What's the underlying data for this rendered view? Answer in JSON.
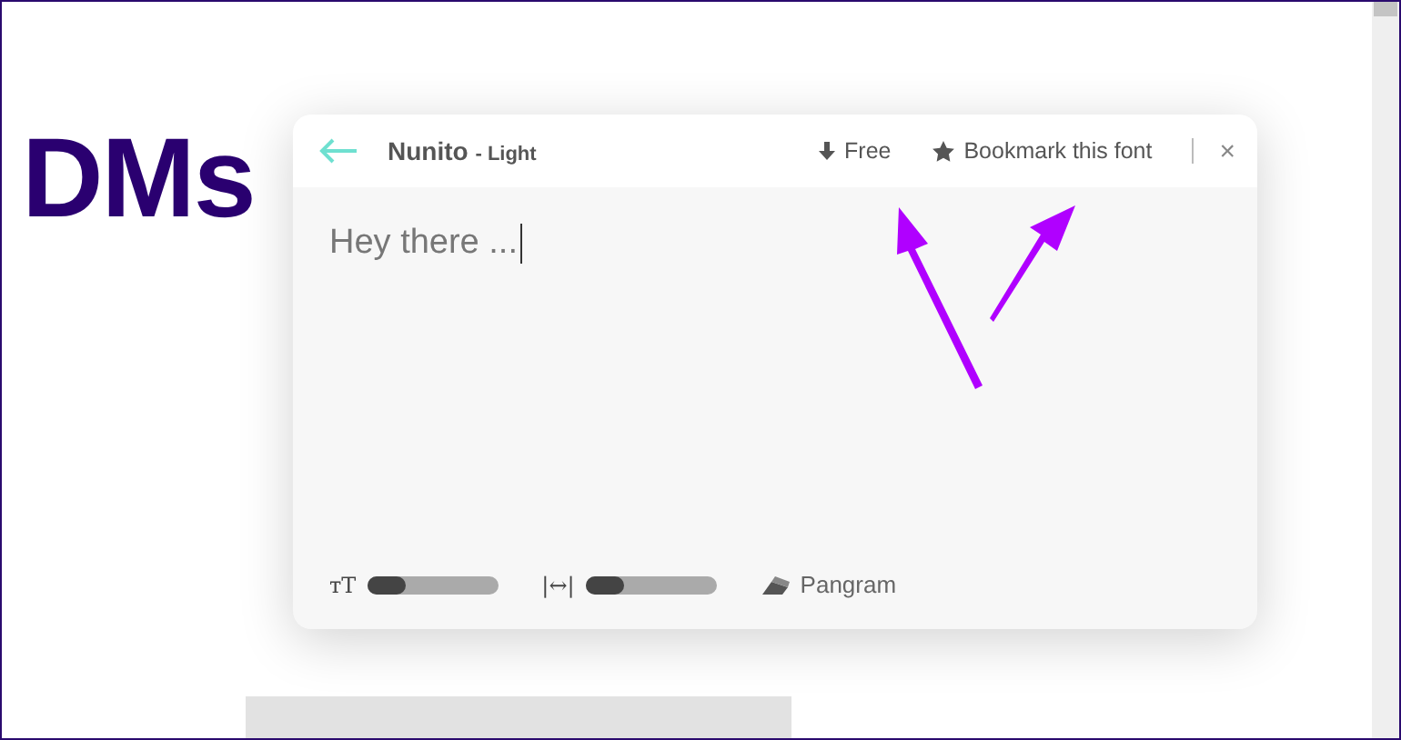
{
  "page": {
    "heading": "DMs"
  },
  "dialog": {
    "font_name": "Nunito",
    "font_style": "- Light",
    "download_label": "Free",
    "bookmark_label": "Bookmark this font",
    "close_label": "×",
    "sample_text": "Hey there ...",
    "controls": [
      {
        "kind": "slider",
        "label": "тT",
        "level": 0.3
      },
      {
        "kind": "slider",
        "label": "|↔|",
        "level": 0.3
      },
      {
        "kind": "button",
        "label": "Pangram"
      }
    ]
  }
}
